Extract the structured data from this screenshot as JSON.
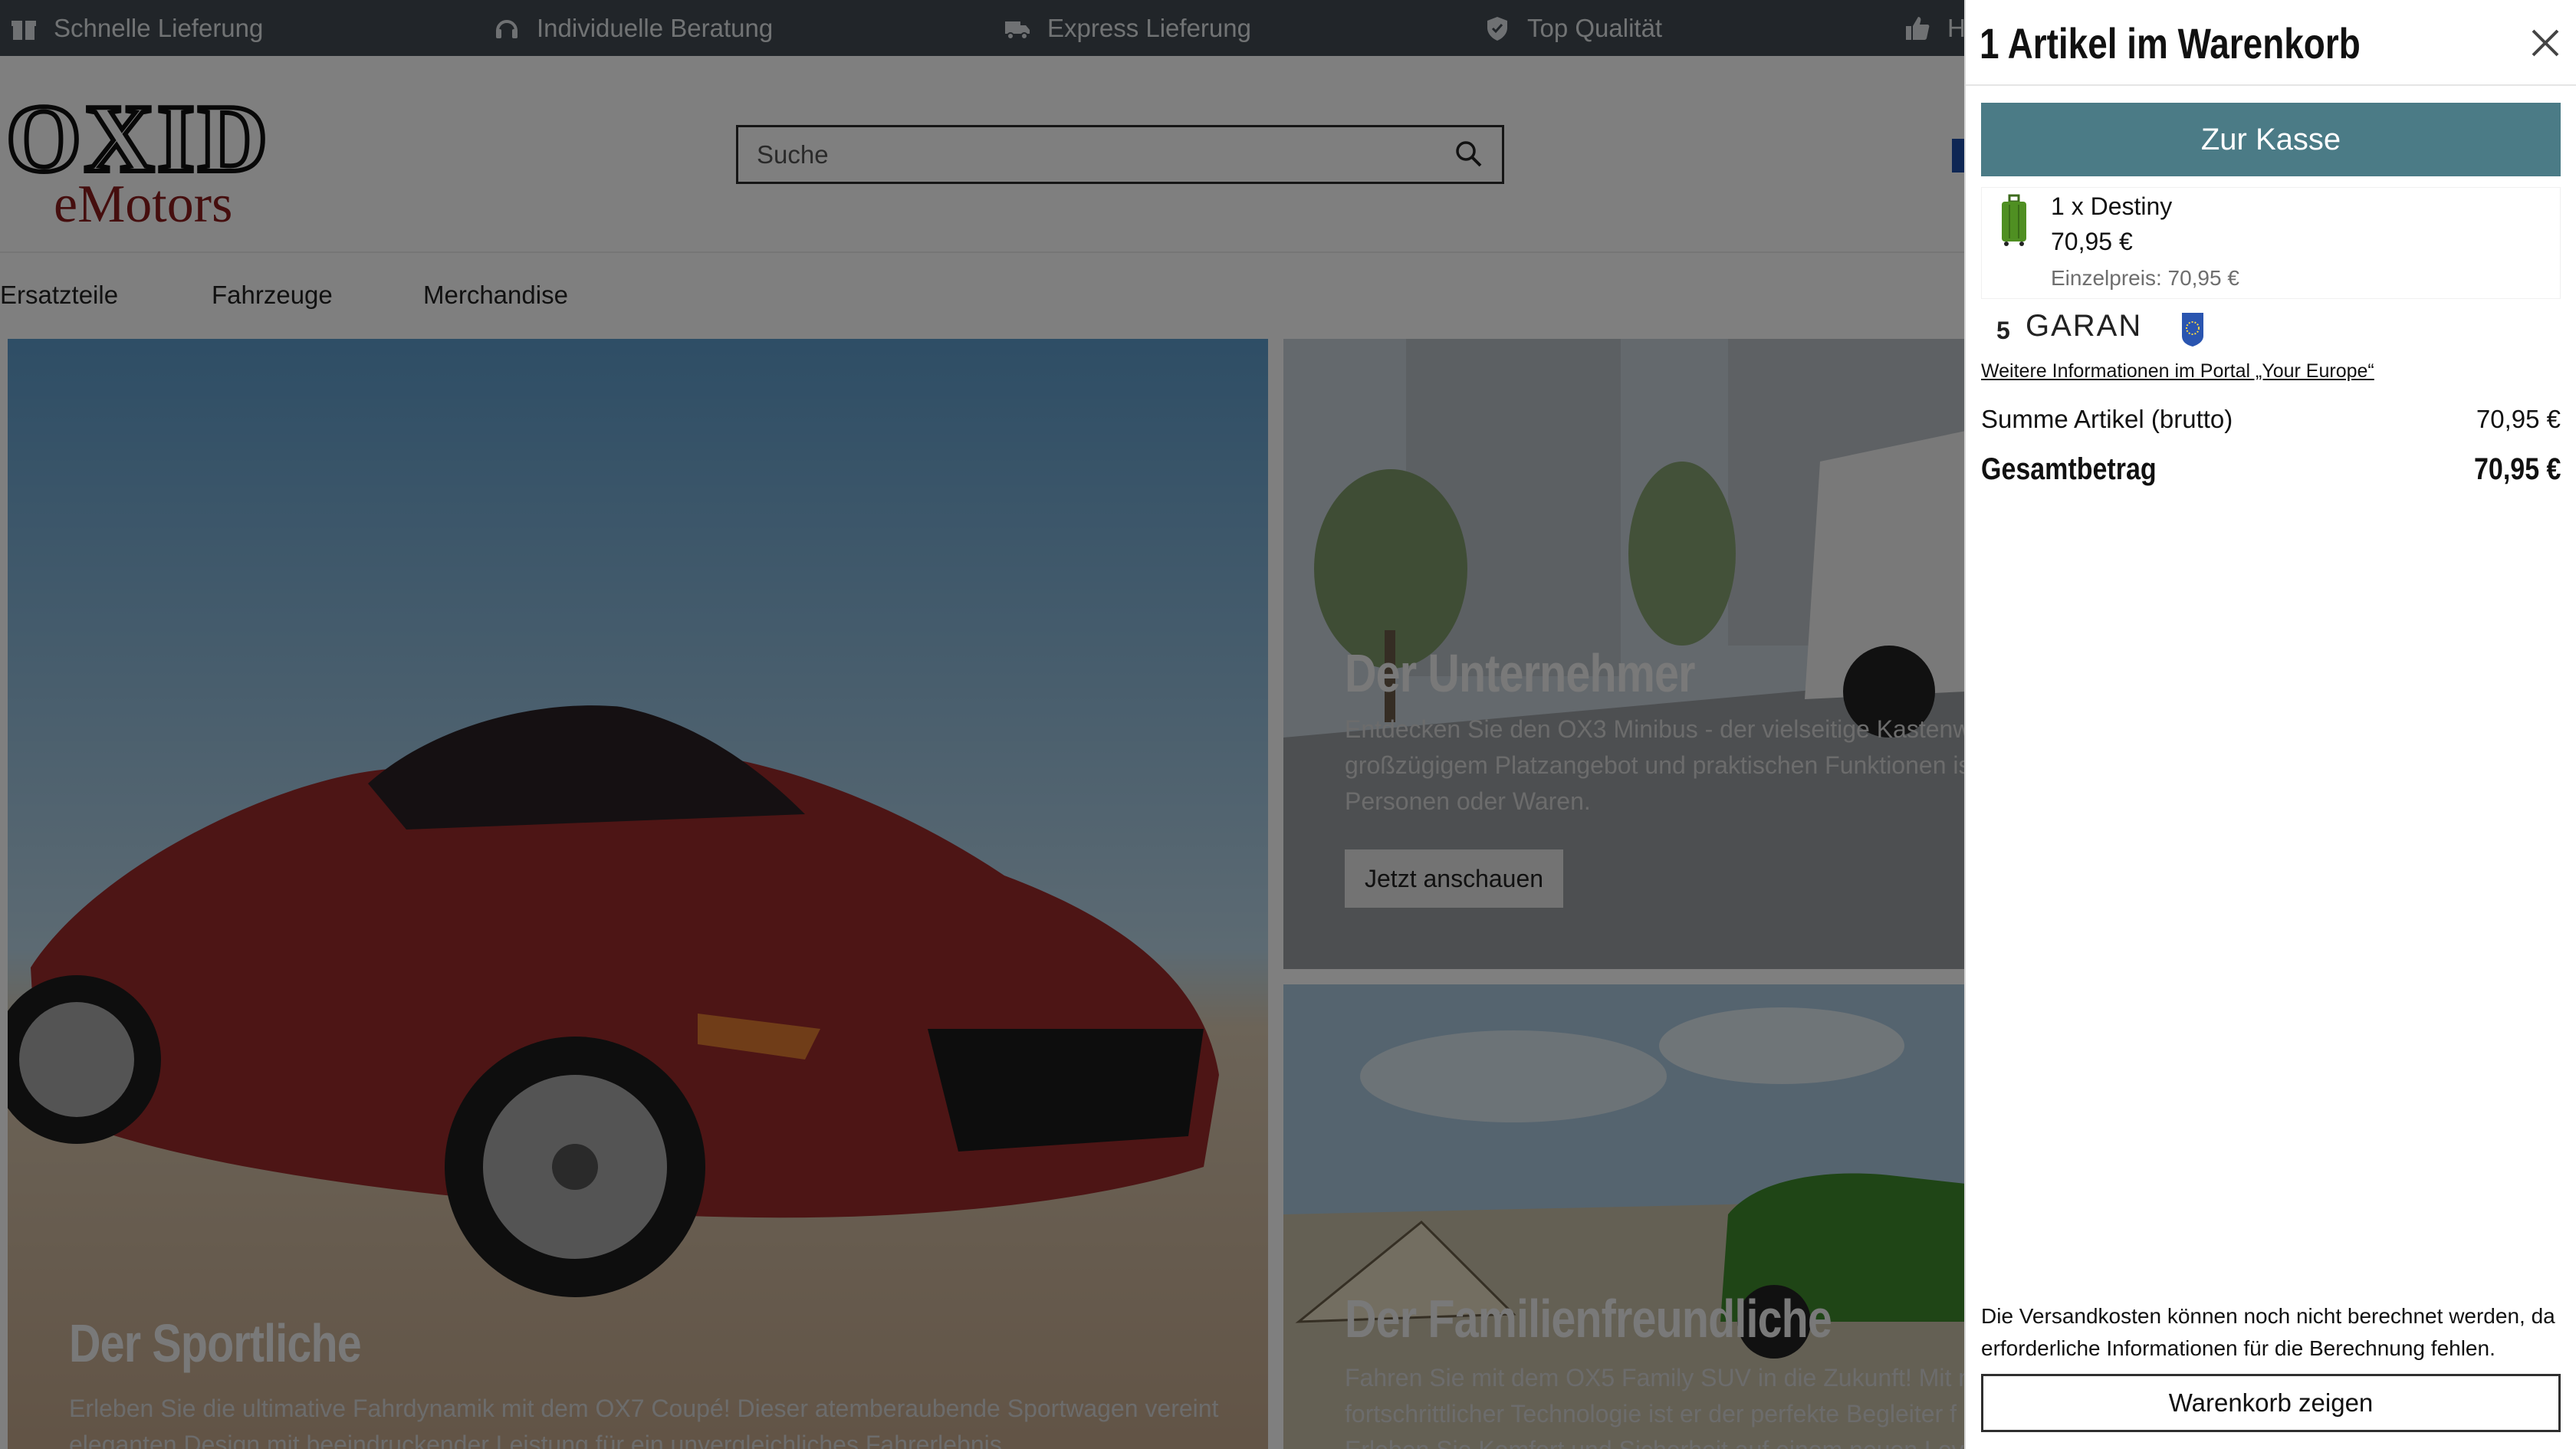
{
  "topbar": {
    "usps": [
      {
        "label": "Schnelle Lieferung",
        "icon": "gift-icon"
      },
      {
        "label": "Individuelle Beratung",
        "icon": "headset-icon"
      },
      {
        "label": "Express Lieferung",
        "icon": "truck-icon"
      },
      {
        "label": "Top Qualität",
        "icon": "shield-check-icon"
      },
      {
        "label": "H",
        "icon": "thumbs-up-icon"
      }
    ]
  },
  "header": {
    "logo_line1": "OXID",
    "logo_line2": "eMotors",
    "search_placeholder": "Suche"
  },
  "nav": {
    "items": [
      "Ersatzteile",
      "Fahrzeuge",
      "Merchandise"
    ]
  },
  "hero": {
    "sport": {
      "title": "Der Sportliche",
      "desc_1": "Erleben Sie die ultimative Fahrdynamik mit dem OX7 Coupé! Dieser atemberaubende Sportwagen vereint",
      "desc_2": "eleganten Design mit beeindruckender Leistung für ein unvergleichliches Fahrerlebnis"
    },
    "business": {
      "title": "Der Unternehmer",
      "desc_1": "Entdecken Sie den OX3 Minibus - der vielseitige Kastenwa",
      "desc_2": "großzügigem Platzangebot und praktischen Funktionen is",
      "desc_3": "Personen oder Waren.",
      "button": "Jetzt anschauen"
    },
    "family": {
      "title": "Der Familienfreundliche",
      "desc_1": "Fahren Sie mit dem OX5 Family SUV in die Zukunft! Mit m",
      "desc_2": "fortschrittlicher Technologie ist er der perfekte Begleiter f",
      "desc_3": "Erleben Sie Komfort und Sicherheit auf einem neuen Lev"
    }
  },
  "cart": {
    "title": "1 Artikel im Warenkorb",
    "checkout": "Zur Kasse",
    "item": {
      "name": "1 x Destiny",
      "price": "70,95 €",
      "unit_price": "Einzelpreis: 70,95 €"
    },
    "guarantee": {
      "years": "5",
      "brand": "GARAN"
    },
    "eu_link": "Weitere Informationen im Portal „Your Europe“",
    "subtotal_label": "Summe Artikel (brutto)",
    "subtotal_value": "70,95 €",
    "total_label": "Gesamtbetrag",
    "total_value": "70,95 €",
    "shipping_note": "Die Versandkosten können noch nicht berechnet werden, da erforderliche Informationen für die Berechnung fehlen.",
    "show_cart": "Warenkorb zeigen"
  },
  "colors": {
    "topbar": "#424b53",
    "checkout_button": "#4b7b86",
    "overlay": "rgba(0,0,0,0.5)"
  }
}
